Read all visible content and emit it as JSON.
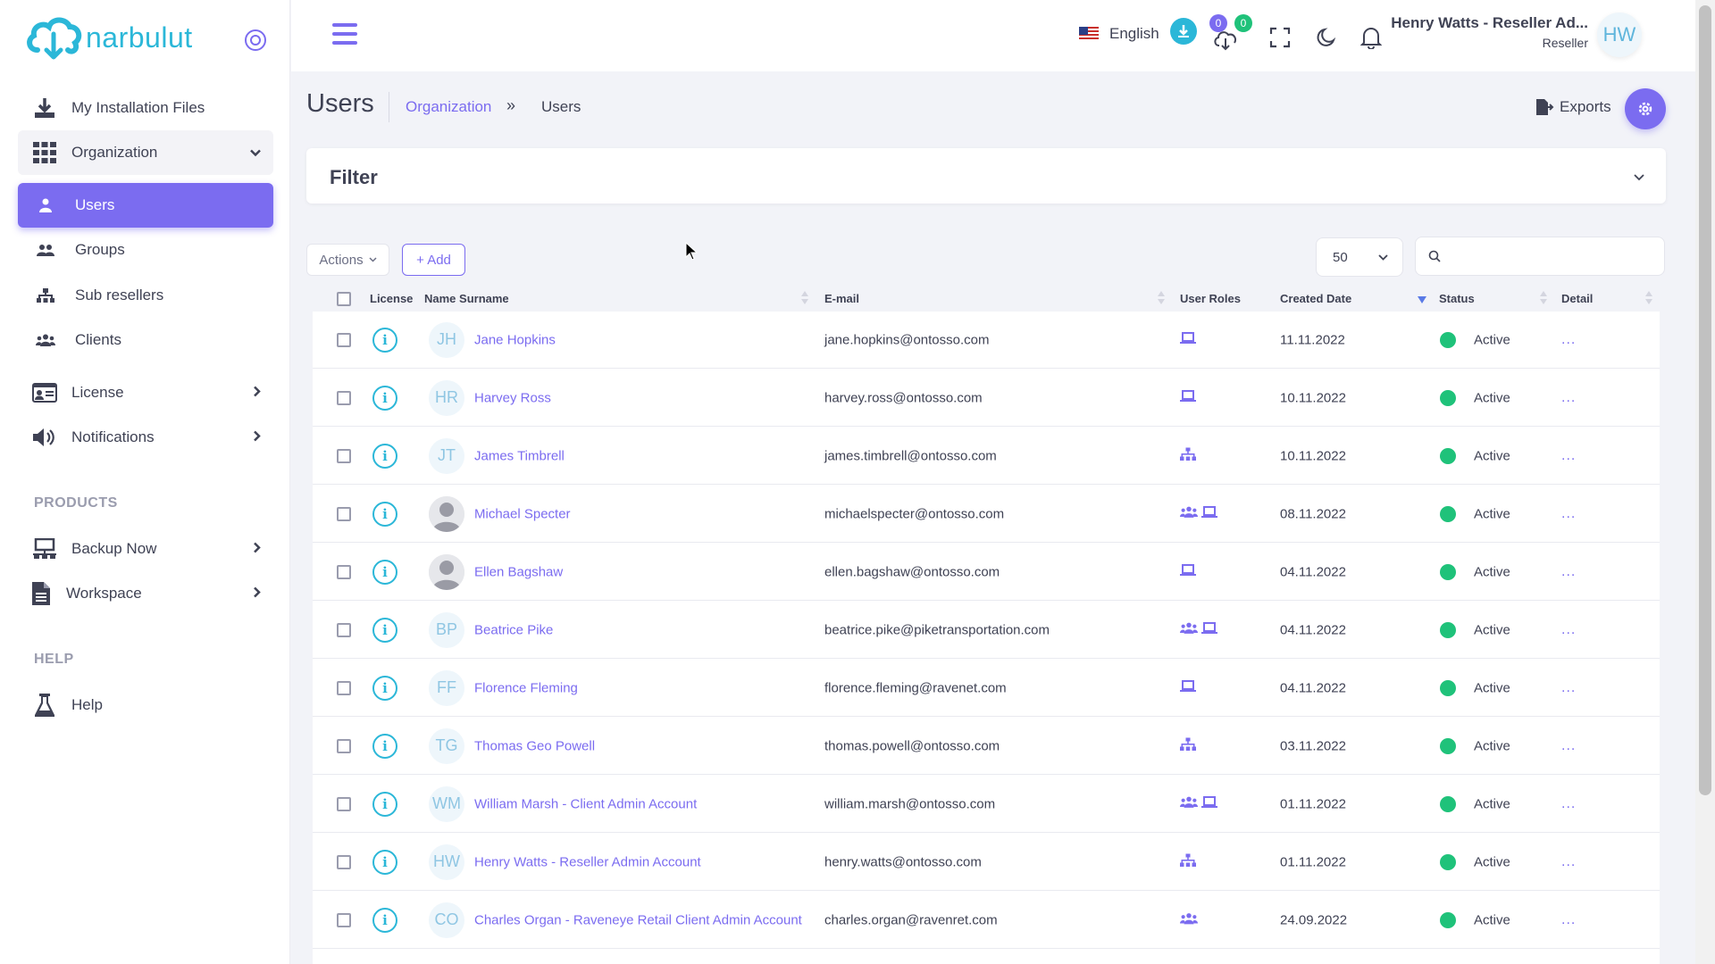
{
  "brand": {
    "name": "narbulut",
    "color": "#2bb7d8",
    "accent": "#7b6cf0"
  },
  "sidebar": {
    "items": [
      {
        "label": "My Installation Files",
        "icon": "download-icon"
      },
      {
        "label": "Organization",
        "icon": "grid-icon"
      },
      {
        "label": "Users",
        "icon": "user-icon"
      },
      {
        "label": "Groups",
        "icon": "users-icon"
      },
      {
        "label": "Sub resellers",
        "icon": "hierarchy-icon"
      },
      {
        "label": "Clients",
        "icon": "clients-icon"
      },
      {
        "label": "License",
        "icon": "id-card-icon"
      },
      {
        "label": "Notifications",
        "icon": "speaker-icon"
      },
      {
        "label": "Backup Now",
        "icon": "network-icon"
      },
      {
        "label": "Workspace",
        "icon": "document-icon"
      },
      {
        "label": "Help",
        "icon": "flask-icon"
      }
    ],
    "sections": {
      "products": "PRODUCTS",
      "help": "HELP"
    }
  },
  "topbar": {
    "language": "English",
    "badges": {
      "uploads": "0",
      "downloads": "0"
    },
    "user_name": "Henry Watts - Reseller Ad...",
    "user_role": "Reseller",
    "user_initials": "HW"
  },
  "page": {
    "title": "Users",
    "breadcrumb": {
      "parent": "Organization",
      "separator": "»",
      "current": "Users"
    },
    "exports_label": "Exports",
    "filter_title": "Filter",
    "actions_label": "Actions",
    "add_label": "+ Add",
    "page_size": "50",
    "search_placeholder": ""
  },
  "table": {
    "columns": [
      "License",
      "Name Surname",
      "E-mail",
      "User Roles",
      "Created Date",
      "Status",
      "Detail"
    ],
    "rows": [
      {
        "initials": "JH",
        "photo": false,
        "name": "Jane Hopkins",
        "email": "jane.hopkins@ontosso.com",
        "roles": [
          "laptop-icon"
        ],
        "created": "11.11.2022",
        "status": "Active"
      },
      {
        "initials": "HR",
        "photo": false,
        "name": "Harvey Ross",
        "email": "harvey.ross@ontosso.com",
        "roles": [
          "laptop-icon"
        ],
        "created": "10.11.2022",
        "status": "Active"
      },
      {
        "initials": "JT",
        "photo": false,
        "name": "James Timbrell",
        "email": "james.timbrell@ontosso.com",
        "roles": [
          "hierarchy-icon"
        ],
        "created": "10.11.2022",
        "status": "Active"
      },
      {
        "initials": "",
        "photo": true,
        "name": "Michael Specter",
        "email": "michaelspecter@ontosso.com",
        "roles": [
          "group-icon",
          "laptop-icon"
        ],
        "created": "08.11.2022",
        "status": "Active"
      },
      {
        "initials": "",
        "photo": true,
        "name": "Ellen Bagshaw",
        "email": "ellen.bagshaw@ontosso.com",
        "roles": [
          "laptop-icon"
        ],
        "created": "04.11.2022",
        "status": "Active"
      },
      {
        "initials": "BP",
        "photo": false,
        "name": "Beatrice Pike",
        "email": "beatrice.pike@piketransportation.com",
        "roles": [
          "group-icon",
          "laptop-icon"
        ],
        "created": "04.11.2022",
        "status": "Active"
      },
      {
        "initials": "FF",
        "photo": false,
        "name": "Florence Fleming",
        "email": "florence.fleming@ravenet.com",
        "roles": [
          "laptop-icon"
        ],
        "created": "04.11.2022",
        "status": "Active"
      },
      {
        "initials": "TG",
        "photo": false,
        "name": "Thomas Geo Powell",
        "email": "thomas.powell@ontosso.com",
        "roles": [
          "hierarchy-icon"
        ],
        "created": "03.11.2022",
        "status": "Active"
      },
      {
        "initials": "WM",
        "photo": false,
        "name": "William Marsh - Client Admin Account",
        "email": "william.marsh@ontosso.com",
        "roles": [
          "group-icon",
          "laptop-icon"
        ],
        "created": "01.11.2022",
        "status": "Active"
      },
      {
        "initials": "HW",
        "photo": false,
        "name": "Henry Watts - Reseller Admin Account",
        "email": "henry.watts@ontosso.com",
        "roles": [
          "hierarchy-icon"
        ],
        "created": "01.11.2022",
        "status": "Active"
      },
      {
        "initials": "CO",
        "photo": false,
        "name": "Charles Organ - Raveneye Retail Client Admin Account",
        "email": "charles.organ@ravenret.com",
        "roles": [
          "group-icon"
        ],
        "created": "24.09.2022",
        "status": "Active"
      }
    ],
    "detail_label": "..."
  },
  "colors": {
    "status_active": "#1fc27a",
    "info": "#2bb7d8",
    "link": "#7b6cf0"
  }
}
